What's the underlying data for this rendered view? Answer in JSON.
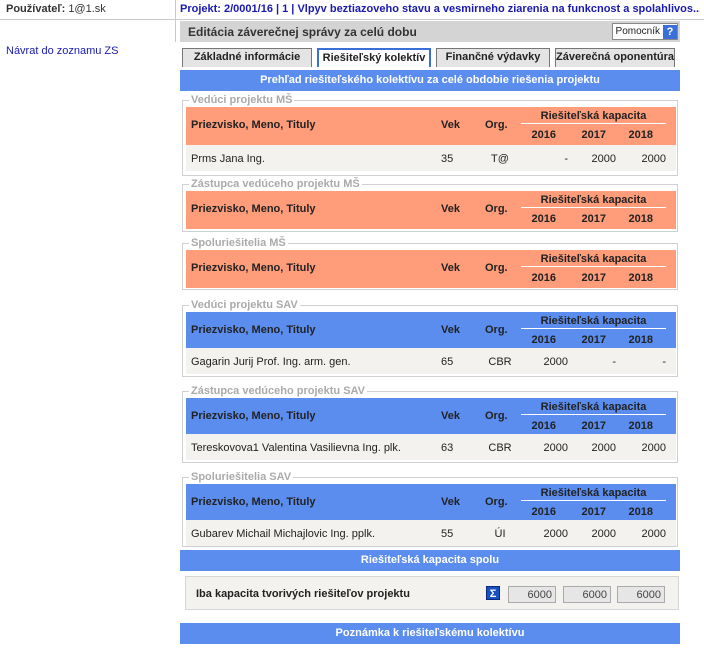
{
  "header": {
    "user_label": "Používateľ:",
    "user_value": "1@1.sk",
    "project_text": "Projekt:  2/0001/16 | 1 | Vlpyv beztiazoveho stavu a vesmirneho ziarenia na funkcnost a spolahlivos..."
  },
  "sidebar": {
    "back_link": "Návrat do zoznamu ZS"
  },
  "titlebar": {
    "title": "Editácia záverečnej správy za celú dobu",
    "help_label": "Pomocník",
    "help_icon": "?"
  },
  "tabs": [
    {
      "label": "Základné informácie"
    },
    {
      "label": "Riešiteľský kolektív"
    },
    {
      "label": "Finančné výdavky"
    },
    {
      "label": "Záverečná oponentúra"
    }
  ],
  "overview_header": "Prehľad riešiteľského kolektívu za celé obdobie riešenia projektu",
  "columns": {
    "name": "Priezvisko, Meno, Tituly",
    "age": "Vek",
    "org": "Org.",
    "capacity": "Riešiteľská kapacita",
    "years": [
      "2016",
      "2017",
      "2018"
    ]
  },
  "sections": [
    {
      "legend": "Vedúci projektu MŠ",
      "rows": [
        {
          "name": "Prms Jana Ing.",
          "age": "35",
          "org": "T@",
          "v": [
            "-",
            "2000",
            "2000"
          ]
        }
      ]
    },
    {
      "legend": "Zástupca vedúceho projektu MŠ",
      "rows": []
    },
    {
      "legend": "Spoluriešitelia MŠ",
      "rows": []
    },
    {
      "legend": "Vedúci projektu SAV",
      "rows": [
        {
          "name": "Gagarin Jurij Prof. Ing. arm. gen.",
          "age": "65",
          "org": "CBR",
          "v": [
            "2000",
            "-",
            "-"
          ]
        }
      ]
    },
    {
      "legend": "Zástupca vedúceho projektu SAV",
      "rows": [
        {
          "name": "Tereskovova1 Valentina Vasilievna Ing. plk.",
          "age": "63",
          "org": "CBR",
          "v": [
            "2000",
            "2000",
            "2000"
          ]
        }
      ]
    },
    {
      "legend": "Spoluriešitelia SAV",
      "rows": [
        {
          "name": "Gubarev Michail Michajlovic Ing. pplk.",
          "age": "55",
          "org": "ÚI",
          "v": [
            "2000",
            "2000",
            "2000"
          ]
        }
      ]
    }
  ],
  "capacity_total": {
    "header": "Riešiteľská kapacita spolu",
    "label": "Iba kapacita tvorivých riešiteľov projektu",
    "sum_icon": "Σ",
    "values": [
      "6000",
      "6000",
      "6000"
    ]
  },
  "note_header": "Poznámka k riešiteľskému kolektívu",
  "colors": {
    "accent_blue": "#5b8def",
    "ms_header": "#ff9c7a",
    "link": "#1a1ab0"
  }
}
